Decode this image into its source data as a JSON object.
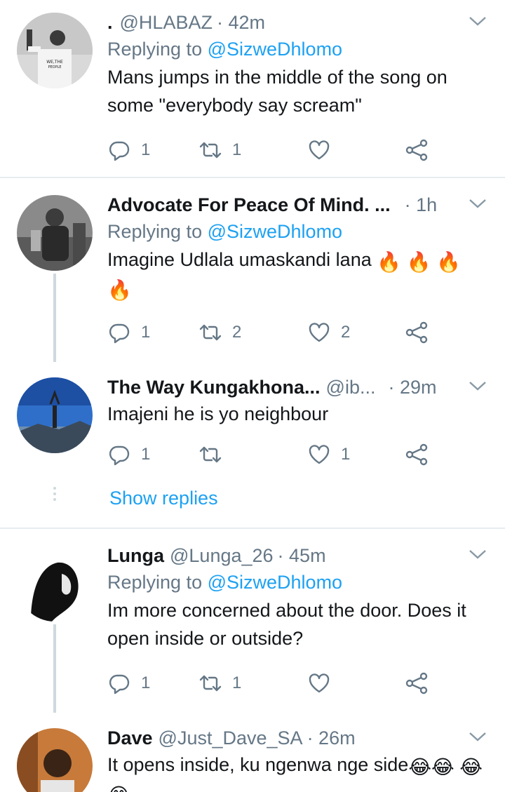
{
  "tweets": [
    {
      "prefix": ".",
      "display_name": "",
      "handle": "@HLABAZ",
      "time": "· 42m",
      "replying_label": "Replying to",
      "replying_to": "@SizweDhlomo",
      "text": "Mans jumps in the middle of the song on some \"everybody say scream\"",
      "replies": "1",
      "retweets": "1",
      "likes": ""
    },
    {
      "display_name": "Advocate For Peace Of Mind. ...",
      "handle": "",
      "time": "· 1h",
      "replying_label": "Replying to",
      "replying_to": "@SizweDhlomo",
      "text": "Imagine Udlala umaskandi lana",
      "emoji": "🔥",
      "replies": "1",
      "retweets": "2",
      "likes": "2"
    },
    {
      "display_name": "The Way Kungakhona...",
      "handle": "@ib...",
      "time": "· 29m",
      "text": "Imajeni he is yo neighbour",
      "replies": "1",
      "retweets": "",
      "likes": "1",
      "show_replies": "Show replies"
    },
    {
      "display_name": "Lunga",
      "handle": "@Lunga_26",
      "time": "· 45m",
      "replying_label": "Replying to",
      "replying_to": "@SizweDhlomo",
      "text": "Im more concerned about the door. Does it open inside or outside?",
      "replies": "1",
      "retweets": "1",
      "likes": ""
    },
    {
      "display_name": "Dave",
      "handle": "@Just_Dave_SA",
      "time": "· 26m",
      "text": "It opens inside, ku ngenwa nge side",
      "emoji": "😂"
    }
  ],
  "icons": [
    "reply-icon",
    "retweet-icon",
    "like-icon",
    "share-icon",
    "caret-down-icon"
  ],
  "colors": {
    "link": "#1da1f2",
    "muted": "#657786",
    "text": "#14171a",
    "divider": "#e6ecf0"
  }
}
